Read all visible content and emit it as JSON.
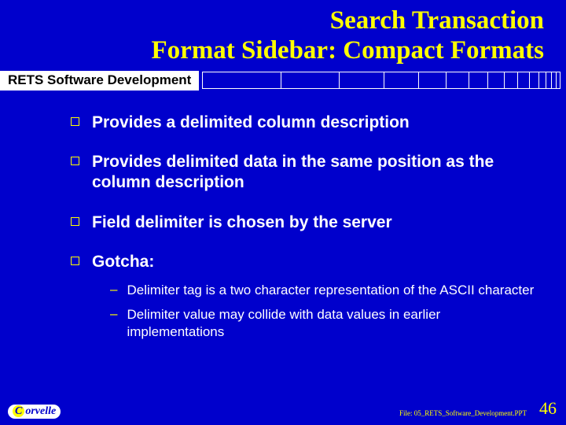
{
  "title_line1": "Search Transaction",
  "title_line2": "Format Sidebar: Compact Formats",
  "subtitle": "RETS Software Development",
  "bullets": [
    {
      "text": "Provides a delimited column description"
    },
    {
      "text": "Provides delimited data in the same position as the column description"
    },
    {
      "text": "Field delimiter is chosen by the server"
    },
    {
      "text": "Gotcha:"
    }
  ],
  "subbullets": [
    {
      "text": "Delimiter tag is a two character representation of the ASCII character"
    },
    {
      "text": "Delimiter value may collide with data values in earlier implementations"
    }
  ],
  "footer": {
    "logo_text": "orvelle",
    "file_label": "File: 05_RETS_Software_Development.PPT",
    "page_number": "46"
  }
}
